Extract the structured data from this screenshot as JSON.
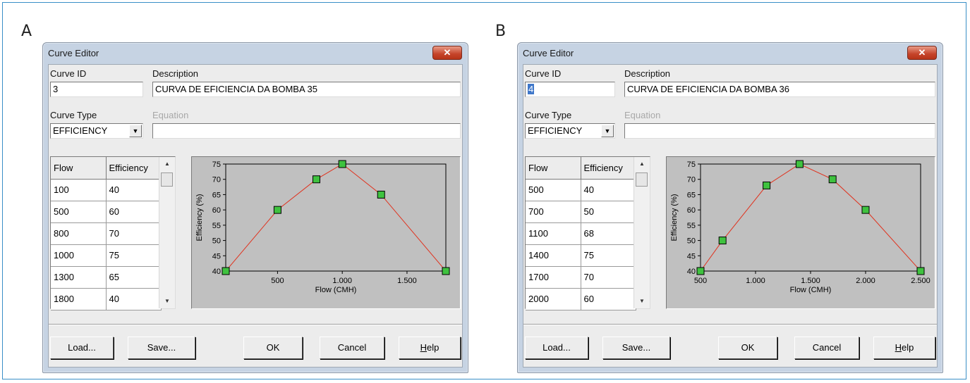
{
  "panels": [
    {
      "letter": "A",
      "window_title": "Curve Editor",
      "close_glyph": "✕",
      "curve_id_label": "Curve ID",
      "curve_id": "3",
      "description_label": "Description",
      "description": "CURVA DE EFICIENCIA DA BOMBA 35",
      "curve_type_label": "Curve Type",
      "curve_type": "EFFICIENCY",
      "equation_label": "Equation",
      "equation": "",
      "table_headers": [
        "Flow",
        "Efficiency"
      ],
      "rows": [
        [
          "100",
          "40"
        ],
        [
          "500",
          "60"
        ],
        [
          "800",
          "70"
        ],
        [
          "1000",
          "75"
        ],
        [
          "1300",
          "65"
        ],
        [
          "1800",
          "40"
        ]
      ],
      "buttons": {
        "load": "Load...",
        "save": "Save...",
        "ok": "OK",
        "cancel": "Cancel",
        "help": "Help"
      },
      "chart_data": {
        "type": "line",
        "x": [
          100,
          500,
          800,
          1000,
          1300,
          1800
        ],
        "y": [
          40,
          60,
          70,
          75,
          65,
          40
        ],
        "xlabel": "Flow (CMH)",
        "ylabel": "Efficiency (%)",
        "xlim": [
          100,
          1800
        ],
        "ylim": [
          40,
          75
        ],
        "xticks": [
          500,
          1000,
          1500
        ],
        "xtick_labels": [
          "500",
          "1.000",
          "1.500"
        ],
        "yticks": [
          40,
          45,
          50,
          55,
          60,
          65,
          70,
          75
        ],
        "line_color": "#e0321e",
        "marker_color": "#3fc23f",
        "grid": false
      }
    },
    {
      "letter": "B",
      "window_title": "Curve Editor",
      "close_glyph": "✕",
      "curve_id_label": "Curve ID",
      "curve_id": "4",
      "description_label": "Description",
      "description": "CURVA DE EFICIENCIA DA BOMBA 36",
      "curve_type_label": "Curve Type",
      "curve_type": "EFFICIENCY",
      "equation_label": "Equation",
      "equation": "",
      "table_headers": [
        "Flow",
        "Efficiency"
      ],
      "rows": [
        [
          "500",
          "40"
        ],
        [
          "700",
          "50"
        ],
        [
          "1100",
          "68"
        ],
        [
          "1400",
          "75"
        ],
        [
          "1700",
          "70"
        ],
        [
          "2000",
          "60"
        ]
      ],
      "buttons": {
        "load": "Load...",
        "save": "Save...",
        "ok": "OK",
        "cancel": "Cancel",
        "help": "Help"
      },
      "chart_data": {
        "type": "line",
        "x": [
          500,
          700,
          1100,
          1400,
          1700,
          2000,
          2500
        ],
        "y": [
          40,
          50,
          68,
          75,
          70,
          60,
          40
        ],
        "xlabel": "Flow (CMH)",
        "ylabel": "Efficiency (%)",
        "xlim": [
          500,
          2500
        ],
        "ylim": [
          40,
          75
        ],
        "xticks": [
          500,
          1000,
          1500,
          2000,
          2500
        ],
        "xtick_labels": [
          "500",
          "1.000",
          "1.500",
          "2.000",
          "2.500"
        ],
        "yticks": [
          40,
          45,
          50,
          55,
          60,
          65,
          70,
          75
        ],
        "line_color": "#e0321e",
        "marker_color": "#3fc23f",
        "grid": false
      }
    }
  ]
}
